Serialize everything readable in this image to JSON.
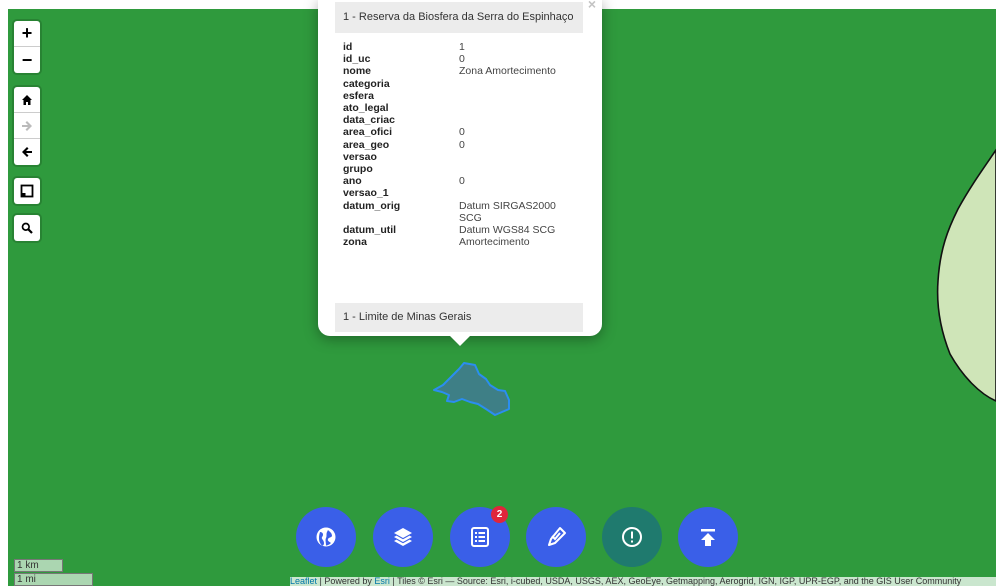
{
  "map": {
    "zoom_in": "+",
    "zoom_out": "−"
  },
  "popup": {
    "header": "1 - Reserva da Biosfera da Serra do Espinhaço",
    "close": "×",
    "attributes": [
      {
        "key": "id",
        "value": "1"
      },
      {
        "key": "id_uc",
        "value": "0"
      },
      {
        "key": "nome",
        "value": "Zona Amortecimento"
      },
      {
        "key": "categoria",
        "value": ""
      },
      {
        "key": "esfera",
        "value": ""
      },
      {
        "key": "ato_legal",
        "value": ""
      },
      {
        "key": "data_criac",
        "value": ""
      },
      {
        "key": "area_ofici",
        "value": "0"
      },
      {
        "key": "area_geo",
        "value": "0"
      },
      {
        "key": "versao",
        "value": ""
      },
      {
        "key": "grupo",
        "value": ""
      },
      {
        "key": "ano",
        "value": "0"
      },
      {
        "key": "versao_1",
        "value": ""
      },
      {
        "key": "datum_orig",
        "value": "Datum SIRGAS2000 SCG"
      },
      {
        "key": "datum_util",
        "value": "Datum WGS84 SCG"
      },
      {
        "key": "zona",
        "value": "Amortecimento"
      }
    ],
    "footer": "1 - Limite de Minas Gerais"
  },
  "toolbar": {
    "badge_count": "2"
  },
  "scale": {
    "km": "1 km",
    "mi": "1 mi"
  },
  "attribution": {
    "leaflet": "Leaflet",
    "powered": " | Powered by ",
    "esri": "Esri",
    "rest": " | Tiles © Esri — Source: Esri, i-cubed, USDA, USGS, AEX, GeoEye, Getmapping, Aerogrid, IGN, IGP, UPR-EGP, and the GIS User Community"
  },
  "colors": {
    "map_green": "#2f9a3d",
    "polygon_fill": "#cfe5b8",
    "button_blue": "#3a5fe8",
    "button_teal": "#1f7a6e",
    "badge_red": "#e0253b"
  }
}
